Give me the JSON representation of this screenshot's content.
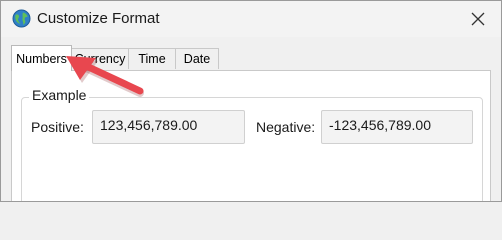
{
  "window": {
    "title": "Customize Format",
    "icon": "globe-icon",
    "close_icon": "close-icon"
  },
  "tabs": [
    {
      "label": "Numbers",
      "active": true
    },
    {
      "label": "Currency",
      "active": false
    },
    {
      "label": "Time",
      "active": false
    },
    {
      "label": "Date",
      "active": false
    }
  ],
  "example": {
    "group_label": "Example",
    "positive_label": "Positive:",
    "positive_value": "123,456,789.00",
    "negative_label": "Negative:",
    "negative_value": "-123,456,789.00"
  },
  "annotation": {
    "arrow_color": "#e8474f",
    "icon": "pointer-arrow-icon"
  }
}
